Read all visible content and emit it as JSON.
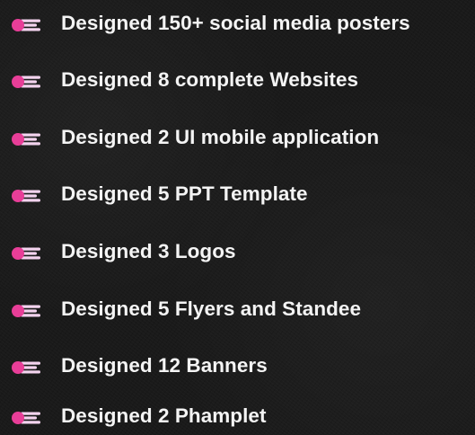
{
  "colors": {
    "bullet_dot": "#e83e98",
    "bullet_bars": "#f3d3ee",
    "text": "#f4f4f4"
  },
  "items": [
    {
      "icon": "bullet-icon",
      "label": "Designed 150+ social media posters"
    },
    {
      "icon": "bullet-icon",
      "label": "Designed 8 complete Websites"
    },
    {
      "icon": "bullet-icon",
      "label": "Designed 2 UI mobile application"
    },
    {
      "icon": "bullet-icon",
      "label": "Designed 5 PPT Template"
    },
    {
      "icon": "bullet-icon",
      "label": "Designed 3 Logos"
    },
    {
      "icon": "bullet-icon",
      "label": "Designed 5 Flyers and Standee"
    },
    {
      "icon": "bullet-icon",
      "label": "Designed 12 Banners"
    },
    {
      "icon": "bullet-icon",
      "label": "Designed 2 Phamplet"
    }
  ]
}
